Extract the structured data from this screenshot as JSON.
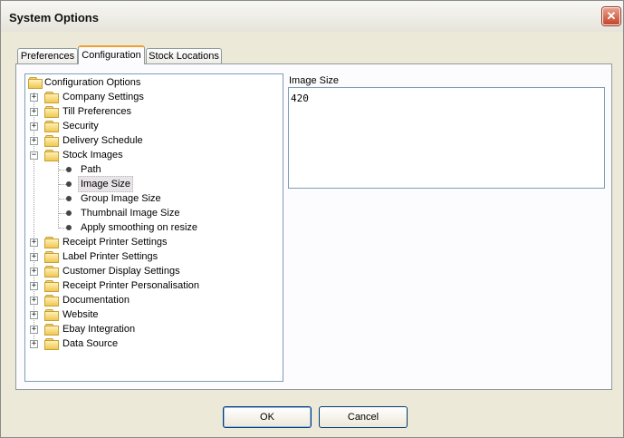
{
  "window": {
    "title": "System Options"
  },
  "tabs": [
    {
      "label": "Preferences",
      "active": false
    },
    {
      "label": "Configuration",
      "active": true
    },
    {
      "label": "Stock Locations",
      "active": false
    }
  ],
  "tree": {
    "root": "Configuration Options",
    "items": [
      {
        "label": "Company Settings",
        "expanded": false
      },
      {
        "label": "Till Preferences",
        "expanded": false
      },
      {
        "label": "Security",
        "expanded": false
      },
      {
        "label": "Delivery Schedule",
        "expanded": false
      },
      {
        "label": "Stock Images",
        "expanded": true,
        "children": [
          "Path",
          "Image Size",
          "Group Image Size",
          "Thumbnail Image Size",
          "Apply smoothing on resize"
        ],
        "selected_child": "Image Size"
      },
      {
        "label": "Receipt Printer Settings",
        "expanded": false
      },
      {
        "label": "Label Printer Settings",
        "expanded": false
      },
      {
        "label": "Customer Display Settings",
        "expanded": false
      },
      {
        "label": "Receipt Printer Personalisation",
        "expanded": false
      },
      {
        "label": "Documentation",
        "expanded": false
      },
      {
        "label": "Website",
        "expanded": false
      },
      {
        "label": "Ebay Integration",
        "expanded": false
      },
      {
        "label": "Data Source",
        "expanded": false
      }
    ]
  },
  "detail": {
    "label": "Image Size",
    "value": "420"
  },
  "buttons": {
    "ok": "OK",
    "cancel": "Cancel"
  }
}
